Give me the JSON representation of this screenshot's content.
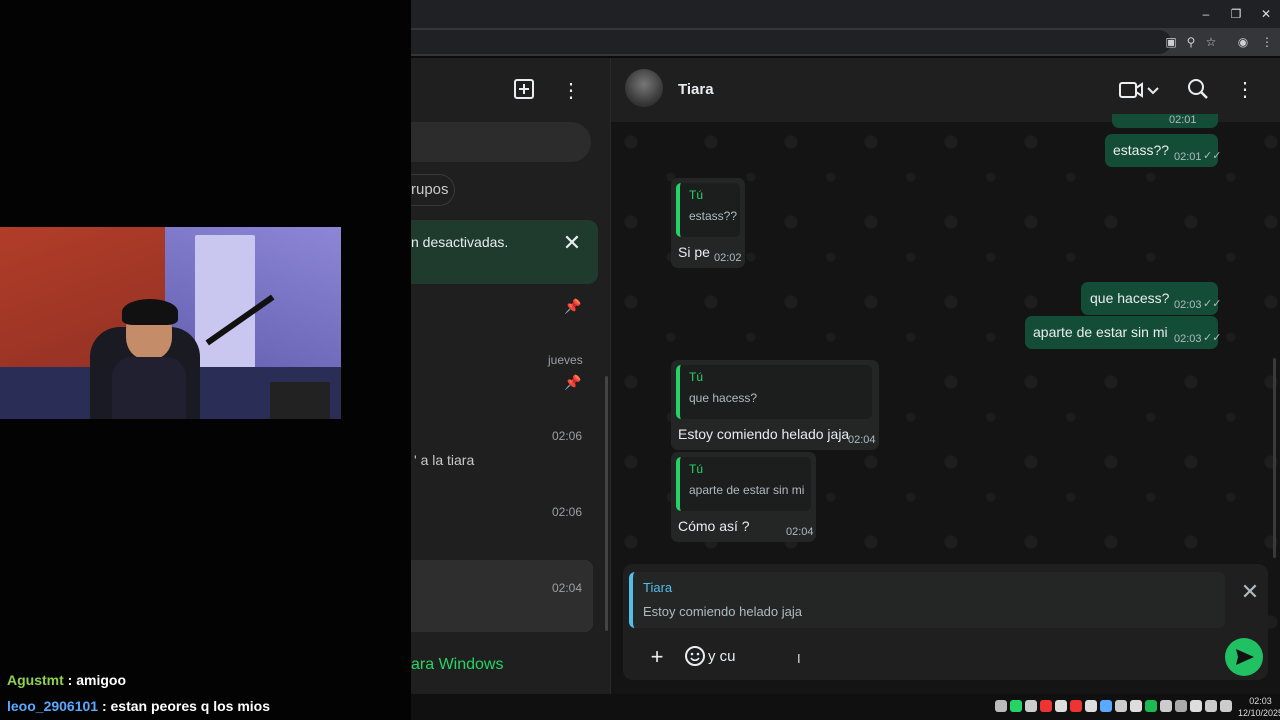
{
  "stream_chat": [
    {
      "user": "Agustmt",
      "text": ": amigoo"
    },
    {
      "user": "leoo_2906101",
      "text": ": estan peores q los mios"
    }
  ],
  "sidebar": {
    "filter_chip": "rupos",
    "notice_text": "n desactivadas.",
    "pinned_day": "jueves",
    "rows": [
      {
        "time": "02:06",
        "preview": "' a la tiara"
      },
      {
        "time": "02:06",
        "preview": ""
      },
      {
        "time": "02:04",
        "preview": ""
      }
    ],
    "get_windows": "ara Windows"
  },
  "chat": {
    "contact_name": "Tiara",
    "messages": [
      {
        "dir": "out",
        "text": "estass??",
        "time": "02:01"
      },
      {
        "dir": "in",
        "quote_author": "Tú",
        "quote_text": "estass??",
        "text": "Si pe",
        "time": "02:02"
      },
      {
        "dir": "out",
        "text": "que hacess?",
        "time": "02:03"
      },
      {
        "dir": "out",
        "text": "aparte de estar sin mi",
        "time": "02:03"
      },
      {
        "dir": "in",
        "quote_author": "Tú",
        "quote_text": "que hacess?",
        "text": "Estoy comiendo helado jaja",
        "time": "02:04"
      },
      {
        "dir": "in",
        "quote_author": "Tú",
        "quote_text": "aparte de estar sin mi",
        "text": "Cómo así ?",
        "time": "02:04"
      }
    ],
    "top_partial_time": "02:01",
    "reply": {
      "author": "Tiara",
      "text": "Estoy comiendo helado jaja"
    },
    "composer_value": "y cu"
  },
  "taskbar": {
    "time": "02:03",
    "date": "12/10/2025"
  },
  "colors": {
    "accent": "#25d366",
    "out_bubble": "#144d37",
    "in_bubble": "#242626",
    "reply_accent": "#53bdeb"
  }
}
